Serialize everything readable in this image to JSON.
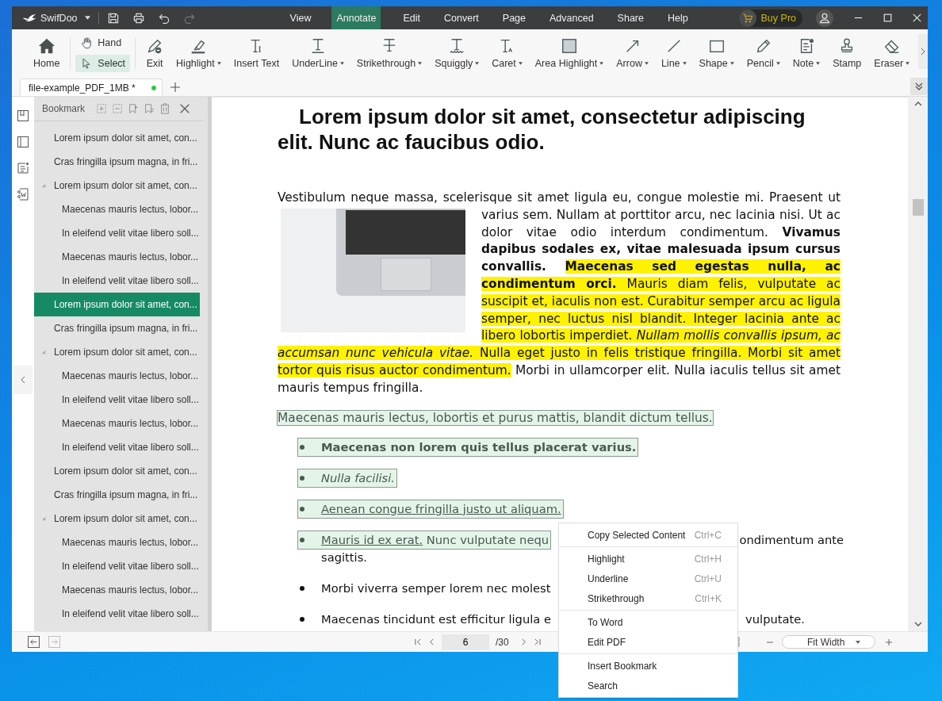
{
  "app": {
    "name": "SwifDoo"
  },
  "menu": [
    {
      "label": "View",
      "selected": false
    },
    {
      "label": "Annotate",
      "selected": true
    },
    {
      "label": "Edit",
      "selected": false
    },
    {
      "label": "Convert",
      "selected": false
    },
    {
      "label": "Page",
      "selected": false
    },
    {
      "label": "Advanced",
      "selected": false
    },
    {
      "label": "Share",
      "selected": false
    },
    {
      "label": "Help",
      "selected": false
    }
  ],
  "buy_pro": {
    "label": "Buy Pro"
  },
  "ribbon": {
    "home": {
      "label": "Home"
    },
    "modes": [
      {
        "label": "Hand",
        "selected": false
      },
      {
        "label": "Select",
        "selected": true
      }
    ],
    "tools": [
      {
        "label": "Exit",
        "dropdown": false
      },
      {
        "label": "Highlight",
        "dropdown": true
      },
      {
        "label": "Insert Text",
        "dropdown": false
      },
      {
        "label": "UnderLine",
        "dropdown": true
      },
      {
        "label": "Strikethrough",
        "dropdown": true
      },
      {
        "label": "Squiggly",
        "dropdown": true
      },
      {
        "label": "Caret",
        "dropdown": true
      },
      {
        "label": "Area Highlight",
        "dropdown": true
      },
      {
        "label": "Arrow",
        "dropdown": true
      },
      {
        "label": "Line",
        "dropdown": true
      },
      {
        "label": "Shape",
        "dropdown": true
      },
      {
        "label": "Pencil",
        "dropdown": true
      },
      {
        "label": "Note",
        "dropdown": true
      },
      {
        "label": "Stamp",
        "dropdown": false
      },
      {
        "label": "Eraser",
        "dropdown": true
      }
    ]
  },
  "tabs": [
    {
      "label": "file-example_PDF_1MB *",
      "selected": true,
      "unsaved": true
    }
  ],
  "bookmark_panel": {
    "title": "Bookmark",
    "items": [
      {
        "label": "Lorem ipsum dolor sit amet, con...",
        "selected": false,
        "expanded": false
      },
      {
        "label": "Cras fringilla ipsum magna, in fri...",
        "selected": false,
        "expanded": false
      },
      {
        "label": "Lorem ipsum dolor sit amet, con...",
        "selected": false,
        "expanded": true,
        "children": [
          {
            "label": "Maecenas mauris lectus, lobor...",
            "selected": false
          },
          {
            "label": "In eleifend velit vitae libero soll...",
            "selected": false
          },
          {
            "label": "Maecenas mauris lectus, lobor...",
            "selected": false
          },
          {
            "label": "In eleifend velit vitae libero soll...",
            "selected": false
          }
        ]
      },
      {
        "label": "Lorem ipsum dolor sit amet, con...",
        "selected": true,
        "expanded": false
      },
      {
        "label": "Cras fringilla ipsum magna, in fri...",
        "selected": false,
        "expanded": false
      },
      {
        "label": "Lorem ipsum dolor sit amet, con...",
        "selected": false,
        "expanded": true,
        "children": [
          {
            "label": "Maecenas mauris lectus, lobor...",
            "selected": false
          },
          {
            "label": "In eleifend velit vitae libero soll...",
            "selected": false
          },
          {
            "label": "Maecenas mauris lectus, lobor...",
            "selected": false
          },
          {
            "label": "In eleifend velit vitae libero soll...",
            "selected": false
          }
        ]
      },
      {
        "label": "Lorem ipsum dolor sit amet, con...",
        "selected": false,
        "expanded": false
      },
      {
        "label": "Cras fringilla ipsum magna, in fri...",
        "selected": false,
        "expanded": false
      },
      {
        "label": "Lorem ipsum dolor sit amet, con...",
        "selected": false,
        "expanded": true,
        "children": [
          {
            "label": "Maecenas mauris lectus, lobor...",
            "selected": false
          },
          {
            "label": "In eleifend velit vitae libero soll...",
            "selected": false
          },
          {
            "label": "Maecenas mauris lectus, lobor...",
            "selected": false
          },
          {
            "label": "In eleifend velit vitae libero soll...",
            "selected": false
          }
        ]
      }
    ]
  },
  "document": {
    "title": "Lorem ipsum dolor sit amet, consectetur adipiscing elit. Nunc ac faucibus odio.",
    "paragraph": [
      {
        "text": "Vestibulum neque massa, scelerisque sit amet ligula eu, congue molestie mi. Praesent ut varius sem. Nullam at porttitor arcu, nec lacinia nisi. Ut ac dolor vitae odio interdum condimentum. ",
        "kind": "plain",
        "highlighted": false
      },
      {
        "text": "Vivamus dapibus sodales ex, vitae malesuada ipsum cursus convallis. ",
        "kind": "bold",
        "highlighted": false
      },
      {
        "text": "Maecenas sed egestas nulla, ac condimentum orci.",
        "kind": "bold",
        "highlighted": true
      },
      {
        "text": " Mauris diam felis, vulputate ac suscipit et, iaculis non est. Curabitur semper arcu ac ligula semper, nec luctus nisl blandit. Integer lacinia ante ac libero lobortis imperdiet. ",
        "kind": "plain",
        "highlighted": true
      },
      {
        "text": "Nullam mollis convallis ipsum, ac accumsan nunc vehicula vitae.",
        "kind": "italic",
        "highlighted": true
      },
      {
        "text": " Nulla eget justo in felis tristique fringilla. Morbi sit amet tortor quis risus auctor condimentum.",
        "kind": "plain",
        "highlighted": true
      },
      {
        "text": " Morbi in ullamcorper elit. Nulla iaculis tellus sit amet mauris tempus fringilla.",
        "kind": "plain",
        "highlighted": false
      }
    ],
    "selected_line": {
      "text": "Maecenas mauris lectus, lobortis et purus mattis, blandit dictum tellus.",
      "annotated": true
    },
    "list": [
      {
        "runs": [
          {
            "text": "Maecenas non lorem quis tellus placerat varius.",
            "kind": "bold"
          }
        ],
        "annotated": true
      },
      {
        "runs": [
          {
            "text": "Nulla facilisi.",
            "kind": "italic"
          }
        ],
        "annotated": true
      },
      {
        "runs": [
          {
            "text": "Aenean congue fringilla justo ut aliquam.",
            "kind": "underline"
          }
        ],
        "annotated": true
      },
      {
        "runs": [
          {
            "text": "Mauris id ex erat.",
            "kind": "underline"
          },
          {
            "text": " Nunc vulputate nequ",
            "kind": "plain"
          }
        ],
        "right_text": "ondimentum ante",
        "continuation": "sagittis.",
        "annotated": true
      },
      {
        "runs": [
          {
            "text": "Morbi viverra semper lorem nec molest",
            "kind": "plain"
          }
        ],
        "annotated": false
      },
      {
        "runs": [
          {
            "text": "Maecenas tincidunt est efficitur ligula e",
            "kind": "plain"
          }
        ],
        "right_text": "vulputate.",
        "annotated": false
      }
    ]
  },
  "status_bar": {
    "back": {
      "disabled": false
    },
    "forward": {
      "disabled": true
    },
    "page": "6",
    "total": "/30",
    "zoom": "Fit Width"
  },
  "context_menu": {
    "groups": [
      [
        {
          "label": "Copy Selected Content",
          "shortcut": "Ctrl+C"
        }
      ],
      [
        {
          "label": "Highlight",
          "shortcut": "Ctrl+H"
        },
        {
          "label": "Underline",
          "shortcut": "Ctrl+U"
        },
        {
          "label": "Strikethrough",
          "shortcut": "Ctrl+K"
        }
      ],
      [
        {
          "label": "To Word"
        },
        {
          "label": "Edit PDF"
        }
      ],
      [
        {
          "label": "Insert Bookmark"
        },
        {
          "label": "Search"
        }
      ]
    ]
  }
}
